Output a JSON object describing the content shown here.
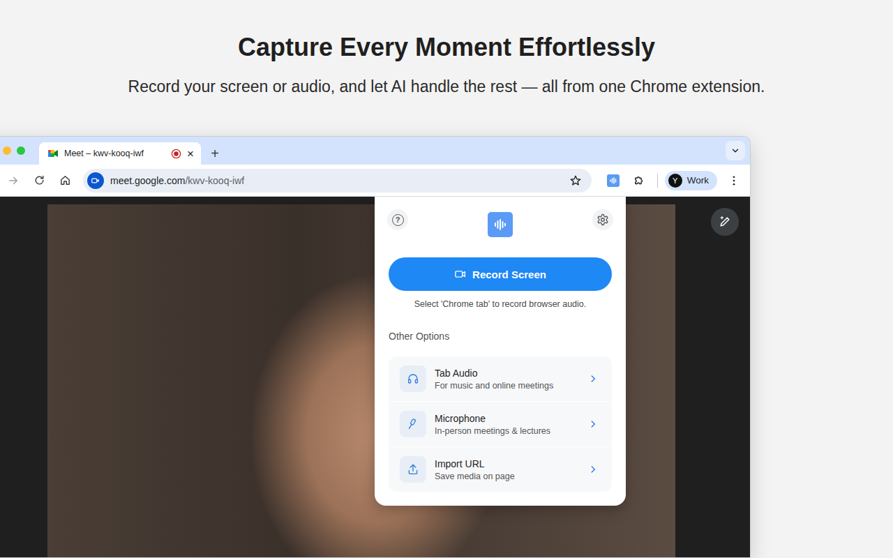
{
  "hero": {
    "title": "Capture Every Moment Effortlessly",
    "subtitle": "Record your screen or audio, and let AI handle the rest — all from one Chrome extension."
  },
  "browser": {
    "tabs": [
      {
        "title": "Meet – kwv-kooq-iwf",
        "selected": true,
        "recording": true,
        "close": "×"
      }
    ],
    "new_tab": "+",
    "toolbar": {
      "forward_disabled": true,
      "url_host": "meet.google.com",
      "url_path": "/kwv-kooq-iwf",
      "bookmarked": false
    },
    "profile": {
      "initial": "Y",
      "label": "Work"
    }
  },
  "popup": {
    "help": "?",
    "record_button": "Record Screen",
    "hint": "Select 'Chrome tab' to record browser audio.",
    "section_title": "Other Options",
    "options": [
      {
        "kind": "headphones",
        "title": "Tab Audio",
        "subtitle": "For music and online meetings"
      },
      {
        "kind": "microphone",
        "title": "Microphone",
        "subtitle": "In-person meetings & lectures"
      },
      {
        "kind": "upload",
        "title": "Import URL",
        "subtitle": "Save media on page"
      }
    ]
  }
}
